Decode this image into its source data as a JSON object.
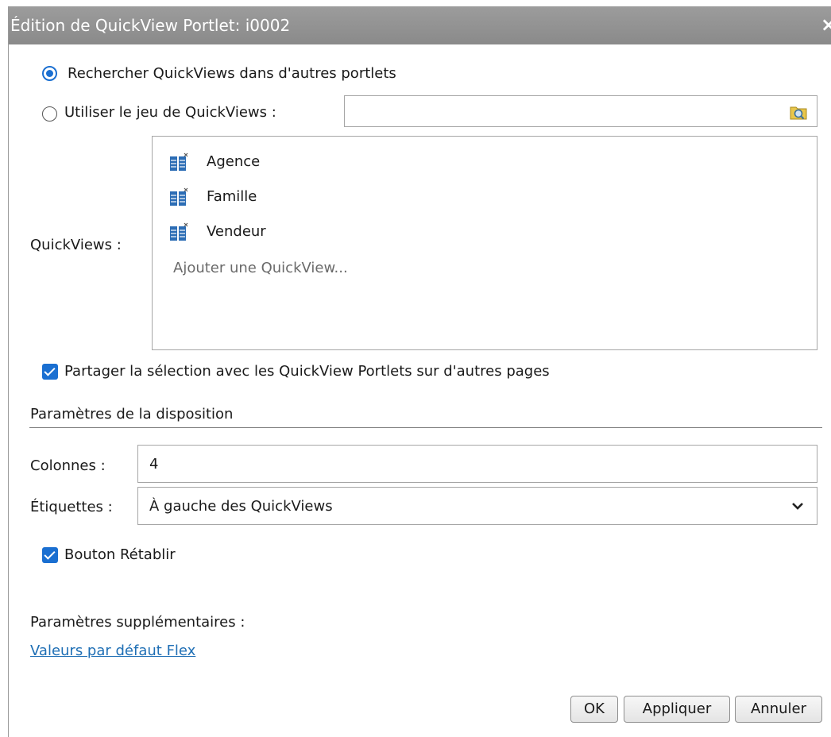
{
  "window": {
    "title": "Édition de QuickView Portlet: i0002",
    "close_glyph": "×"
  },
  "source": {
    "radio_search_label": "Rechercher QuickViews dans d'autres portlets",
    "radio_search_checked": true,
    "radio_use_set_label": "Utiliser le jeu de QuickViews :",
    "radio_use_set_checked": false,
    "set_input_value": "",
    "browse_icon": "folder-search-icon"
  },
  "quickviews": {
    "label": "QuickViews :",
    "items": [
      {
        "label": "Agence",
        "icon": "quickview-table-icon"
      },
      {
        "label": "Famille",
        "icon": "quickview-table-icon"
      },
      {
        "label": "Vendeur",
        "icon": "quickview-table-icon"
      }
    ],
    "add_label": "Ajouter une QuickView..."
  },
  "share_selection": {
    "label": "Partager la sélection avec les QuickView Portlets sur d'autres pages",
    "checked": true
  },
  "layout": {
    "section_title": "Paramètres de la disposition",
    "columns_label": "Colonnes :",
    "columns_value": "4",
    "labels_label": "Étiquettes :",
    "labels_value": "À gauche des QuickViews",
    "reset_button_label": "Bouton Rétablir",
    "reset_button_checked": true
  },
  "extra": {
    "title": "Paramètres supplémentaires :",
    "link_label": "Valeurs par défaut Flex"
  },
  "buttons": {
    "ok": "OK",
    "apply": "Appliquer",
    "cancel": "Annuler"
  },
  "colors": {
    "accent": "#1a6fd1",
    "titlebar": "#939393",
    "link": "#1f6fb5"
  }
}
